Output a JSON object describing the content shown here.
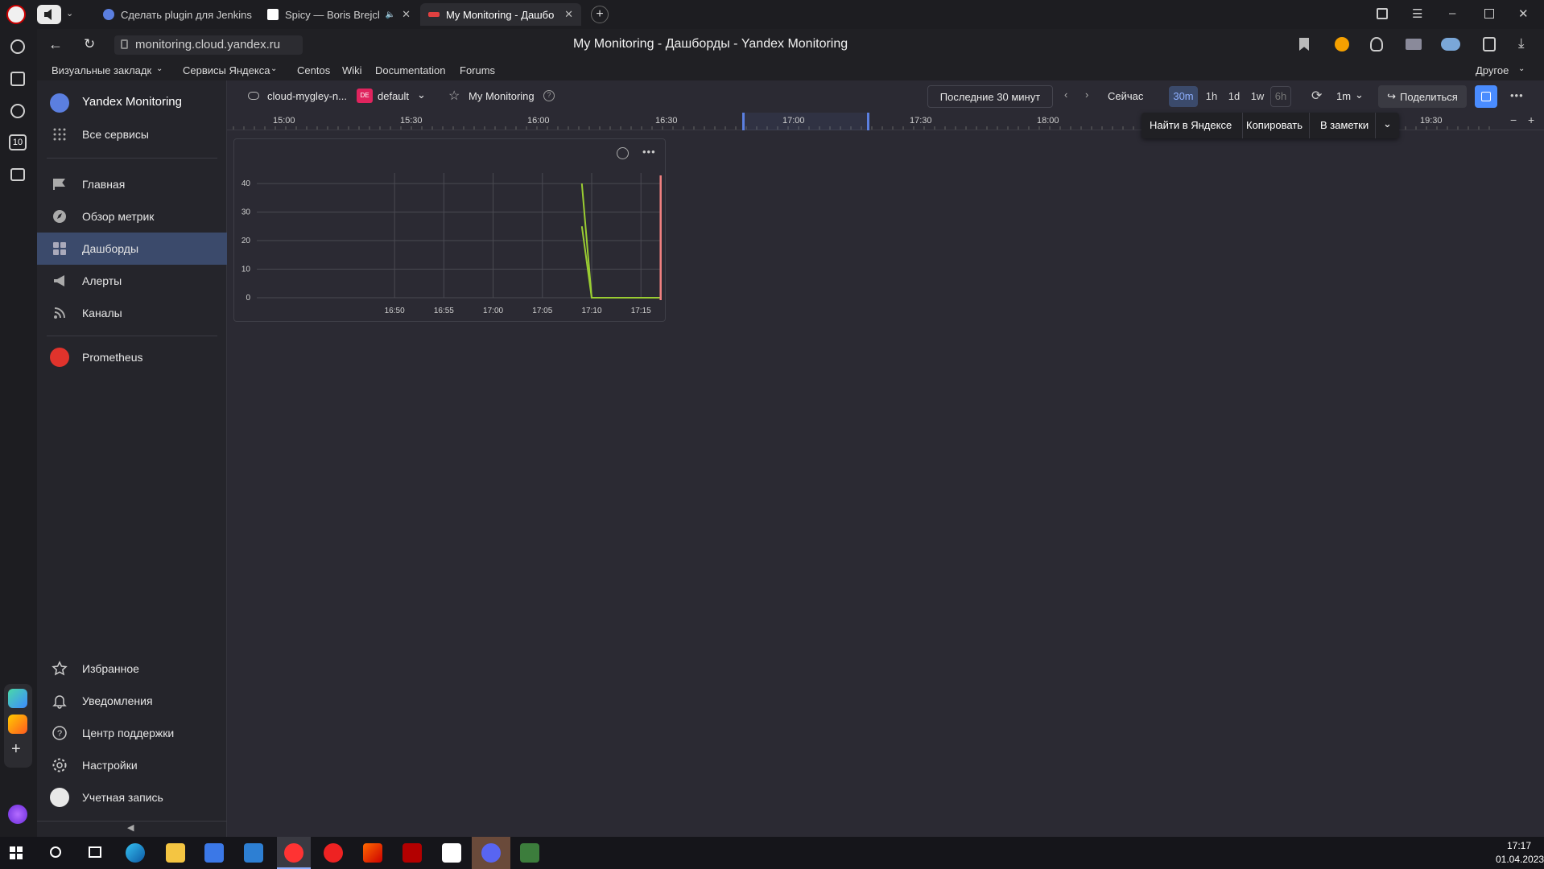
{
  "browser": {
    "tabs": [
      {
        "title": "Сделать plugin для Jenkins"
      },
      {
        "title": "Spicy — Boris Brejcha"
      },
      {
        "title": "My Monitoring - Дашбо"
      }
    ],
    "url": "monitoring.cloud.yandex.ru",
    "page_title": "My Monitoring - Дашборды - Yandex Monitoring",
    "side_badge": "10",
    "bookmarks": [
      "Визуальные закладк",
      "Сервисы Яндекса",
      "Centos",
      "Wiki",
      "Documentation",
      "Forums"
    ],
    "bookmarks_other": "Другое"
  },
  "sidebar": {
    "product": "Yandex Monitoring",
    "all_services": "Все сервисы",
    "items": [
      {
        "label": "Главная"
      },
      {
        "label": "Обзор метрик"
      },
      {
        "label": "Дашборды"
      },
      {
        "label": "Алерты"
      },
      {
        "label": "Каналы"
      }
    ],
    "prometheus": "Prometheus",
    "bottom": [
      {
        "label": "Избранное"
      },
      {
        "label": "Уведомления"
      },
      {
        "label": "Центр поддержки"
      },
      {
        "label": "Настройки"
      },
      {
        "label": "Учетная запись"
      }
    ]
  },
  "toolbar": {
    "cloud": "cloud-myglеy-n...",
    "folder_badge": "DE",
    "folder": "default",
    "dashboard": "My Monitoring",
    "range": "Последние 30 минут",
    "now": "Сейчас",
    "presets": [
      "30m",
      "1h",
      "1d",
      "1w",
      "6h"
    ],
    "refresh": "1m",
    "share": "Поделиться"
  },
  "timeline": {
    "ticks": [
      "15:00",
      "15:30",
      "16:00",
      "16:30",
      "17:00",
      "17:30",
      "18:00",
      "19:30"
    ]
  },
  "popup": {
    "find": "Найти в Яндексе",
    "copy": "Копировать",
    "notes": "В заметки"
  },
  "chart_data": {
    "type": "line",
    "title": "",
    "xlabel": "",
    "ylabel": "",
    "x_ticks": [
      "16:50",
      "16:55",
      "17:00",
      "17:05",
      "17:10",
      "17:15"
    ],
    "y_ticks": [
      "0",
      "10",
      "20",
      "30",
      "40"
    ],
    "ylim": [
      0,
      42
    ],
    "xlim_minutes": [
      -23,
      10
    ],
    "grid": true,
    "colors": {
      "line": "#9acd32",
      "now_marker": "#f08080"
    },
    "series": [
      {
        "points": [
          {
            "x": "17:09",
            "y": 25
          },
          {
            "x": "17:10",
            "y": 0
          }
        ]
      },
      {
        "points": [
          {
            "x": "17:09",
            "y": 40
          },
          {
            "x": "17:10",
            "y": 0
          },
          {
            "x": "17:17",
            "y": 0
          }
        ]
      }
    ],
    "now_marker": "17:17"
  },
  "taskbar": {
    "time": "17:17",
    "date": "01.04.2023"
  }
}
